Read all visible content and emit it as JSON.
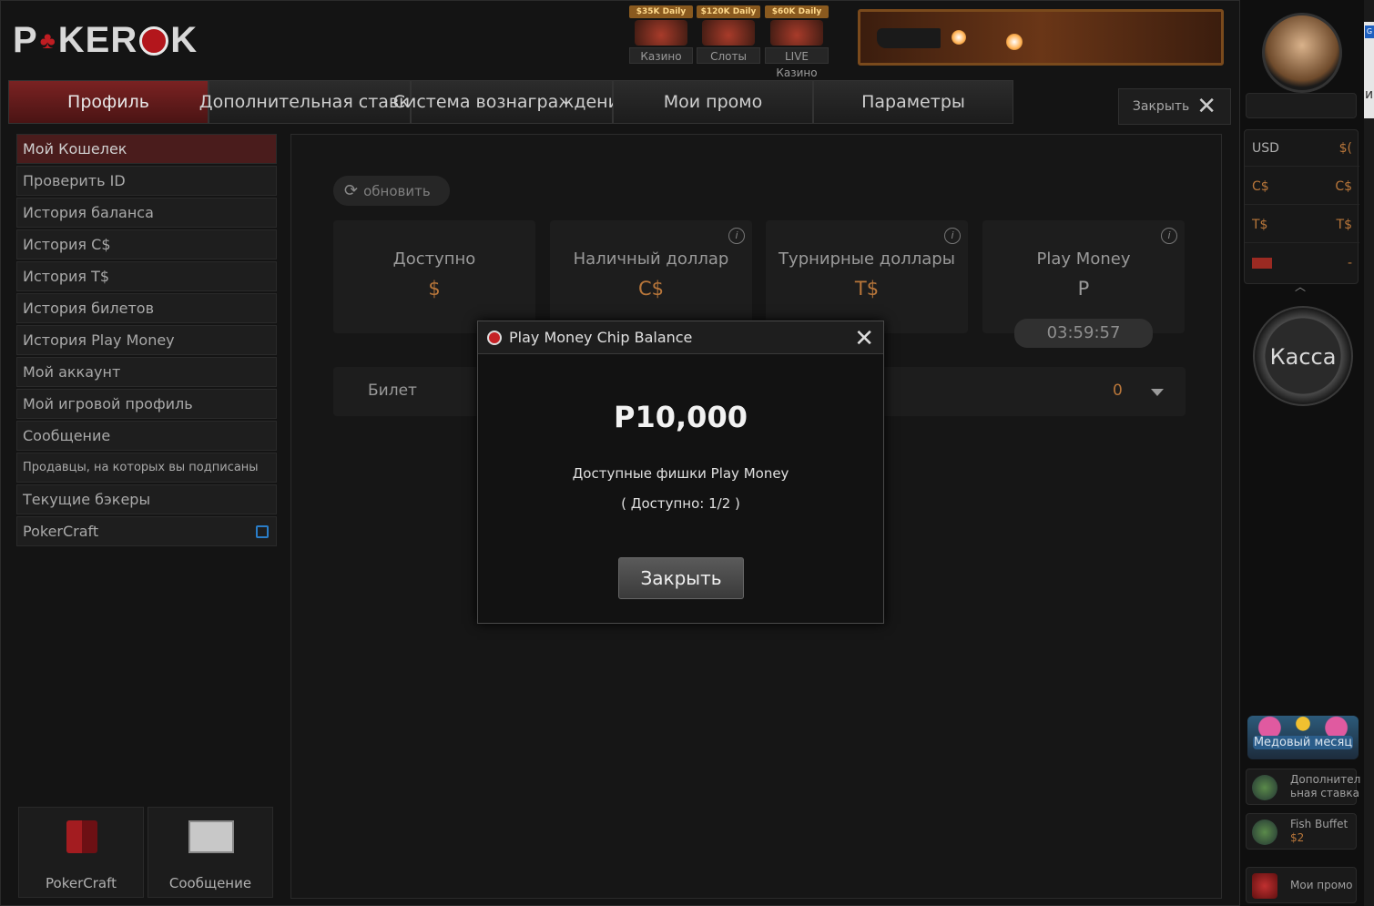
{
  "app": {
    "logo_text_left": "P",
    "logo_text_mid": "KER",
    "logo_text_right": "K"
  },
  "games": [
    {
      "banner": "$35K Daily",
      "label": "Казино"
    },
    {
      "banner": "$120K Daily",
      "label": "Слоты"
    },
    {
      "banner": "$60K Daily",
      "label": "LIVE Казино"
    }
  ],
  "tabs": [
    {
      "label": "Профиль",
      "active": true
    },
    {
      "label": "Дополнительная ставка"
    },
    {
      "label": "Система вознаграждений"
    },
    {
      "label": "Мои промо"
    },
    {
      "label": "Параметры"
    }
  ],
  "close_top": "Закрыть",
  "side_menu": [
    {
      "label": "Мой Кошелек",
      "active": true
    },
    {
      "label": "Проверить ID"
    },
    {
      "label": "История баланса"
    },
    {
      "label": "История C$"
    },
    {
      "label": "История T$"
    },
    {
      "label": "История билетов"
    },
    {
      "label": "История Play Money"
    },
    {
      "label": "Мой аккаунт"
    },
    {
      "label": "Мой игровой профиль"
    },
    {
      "label": "Сообщение"
    },
    {
      "label": "Продавцы, на которых вы подписаны"
    },
    {
      "label": "Текущие бэкеры"
    },
    {
      "label": "PokerCraft"
    }
  ],
  "bottom_buttons": {
    "pokercraft": "PokerCraft",
    "message": "Сообщение"
  },
  "wallet": {
    "refresh": "обновить",
    "cards": [
      {
        "title": "Доступно",
        "value": "$"
      },
      {
        "title": "Наличный доллар",
        "value": "C$"
      },
      {
        "title": "Турнирные доллары",
        "value": "T$"
      },
      {
        "title": "Play Money",
        "value": "P"
      }
    ],
    "timer": "03:59:57",
    "ticket_label": "Билет",
    "ticket_value": "0"
  },
  "modal": {
    "title": "Play Money Chip Balance",
    "amount": "P10,000",
    "description": "Доступные фишки Play Money",
    "available": "( Доступно: 1/2 )",
    "close_button": "Закрыть"
  },
  "balances": [
    {
      "key": "USD",
      "value": "$("
    },
    {
      "key": "C$",
      "value": "C$"
    },
    {
      "key": "T$",
      "value": "T$"
    },
    {
      "key": "",
      "value": "-"
    }
  ],
  "cashier": "Касса",
  "promos": {
    "honey_month": "Медовый месяц",
    "extra_bet_line1": "Дополнител",
    "extra_bet_line2": "ьная ставка",
    "fish_buffet": "Fish Buffet",
    "fish_buffet_sub": "$2",
    "my_promos": "Мои промо"
  },
  "edge": {
    "badge": "G",
    "letter": "и"
  },
  "colors": {
    "accent": "#b8763a",
    "active_tab": "#7a2222",
    "brand_red": "#c01d22"
  }
}
